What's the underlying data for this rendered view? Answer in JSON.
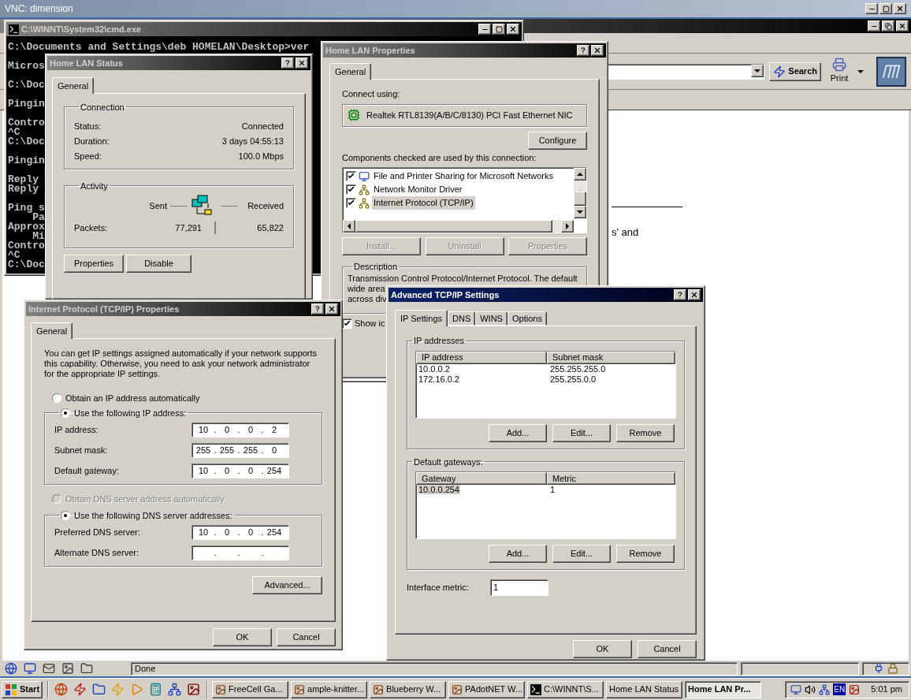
{
  "vnc": {
    "title": "VNC: dimension"
  },
  "browser": {
    "window": {
      "active": false
    },
    "search_button": "Search",
    "print_button": "Print",
    "content_text": "s' and",
    "status_text": "Done"
  },
  "cmd": {
    "window": {
      "title": "C:\\WINNT\\System32\\cmd.exe",
      "active": false
    },
    "blocks": [
      [
        "C:\\Documents and Settings\\deb HOMELAN\\Desktop>ver"
      ],
      [
        "Micros"
      ],
      [
        "C:\\Doc"
      ],
      [
        "Pingin"
      ],
      [
        "Contro",
        "^C",
        "C:\\Doc"
      ],
      [
        "Pingin"
      ],
      [
        "Reply",
        "Reply"
      ],
      [
        "Ping s",
        "    Pa",
        "Approx",
        "    Mi",
        "Contro",
        "^C",
        "C:\\Doc"
      ]
    ]
  },
  "lan_status": {
    "window": {
      "title": "Home LAN Status",
      "active": false
    },
    "tabs": [
      {
        "label": "General",
        "selected": true
      }
    ],
    "connection": {
      "title": "Connection",
      "rows": [
        {
          "label": "Status:",
          "value": "Connected"
        },
        {
          "label": "Duration:",
          "value": "3 days 04:55:13"
        },
        {
          "label": "Speed:",
          "value": "100.0 Mbps"
        }
      ]
    },
    "activity": {
      "title": "Activity",
      "sent_label": "Sent",
      "received_label": "Received",
      "packets_label": "Packets:",
      "packets_sent": "77,291",
      "packets_received": "65,822"
    },
    "buttons": [
      "Properties",
      "Disable"
    ]
  },
  "lan_properties": {
    "window": {
      "title": "Home LAN Properties",
      "active": false
    },
    "tabs": [
      {
        "label": "General",
        "selected": true
      }
    ],
    "connect_label": "Connect using:",
    "adapter": "Realtek RTL8139(A/B/C/8130) PCI Fast Ethernet NIC",
    "configure_button": "Configure",
    "components_label": "Components checked are used by this connection:",
    "components": [
      {
        "label": "File and Printer Sharing for Microsoft Networks",
        "kind": "service",
        "checked": true,
        "selected": false
      },
      {
        "label": "Network Monitor Driver",
        "kind": "protocol",
        "checked": true,
        "selected": false
      },
      {
        "label": "Internet Protocol (TCP/IP)",
        "kind": "protocol",
        "checked": true,
        "selected": true
      }
    ],
    "buttons": [
      {
        "label": "Install...",
        "disabled": true
      },
      {
        "label": "Uninstall",
        "disabled": true
      },
      {
        "label": "Properties",
        "disabled": true
      }
    ],
    "description": {
      "title": "Description",
      "lines": [
        "Transmission Control Protocol/Internet Protocol. The default",
        "wide area",
        "across div"
      ]
    },
    "show_icon": {
      "label": "Show ic",
      "checked": true
    }
  },
  "tcpip": {
    "window": {
      "title": "Internet Protocol (TCP/IP) Properties",
      "active": false
    },
    "tabs": [
      {
        "label": "General",
        "selected": true
      }
    ],
    "intro": "You can get IP settings assigned automatically if your network supports this capability. Otherwise, you need to ask your network administrator for the appropriate IP settings.",
    "ip_options": [
      {
        "label": "Obtain an IP address automatically",
        "selected": false,
        "disabled": false
      },
      {
        "label": "Use the following IP address:",
        "selected": true,
        "disabled": false
      }
    ],
    "ip_fields": [
      {
        "label": "IP address:",
        "octets": [
          "10",
          "0",
          "0",
          "2"
        ],
        "separator": "."
      },
      {
        "label": "Subnet mask:",
        "octets": [
          "255",
          "255",
          "255",
          "0"
        ],
        "separator": "."
      },
      {
        "label": "Default gateway:",
        "octets": [
          "10",
          "0",
          "0",
          "254"
        ],
        "separator": "."
      }
    ],
    "dns_options": [
      {
        "label": "Obtain DNS server address automatically",
        "selected": false,
        "disabled": true
      },
      {
        "label": "Use the following DNS server addresses:",
        "selected": true,
        "disabled": false
      }
    ],
    "dns_fields": [
      {
        "label": "Preferred DNS server:",
        "octets": [
          "10",
          "0",
          "0",
          "254"
        ],
        "separator": "."
      },
      {
        "label": "Alternate DNS server:",
        "separator": "."
      }
    ],
    "advanced_button": "Advanced...",
    "ok_button": "OK",
    "cancel_button": "Cancel"
  },
  "advanced": {
    "window": {
      "title": "Advanced TCP/IP Settings",
      "active": true
    },
    "tabs": [
      {
        "label": "IP Settings",
        "selected": true
      },
      {
        "label": "DNS",
        "selected": false
      },
      {
        "label": "WINS",
        "selected": false
      },
      {
        "label": "Options",
        "selected": false
      }
    ],
    "ip_addresses": {
      "title": "IP addresses",
      "columns": [
        "IP address",
        "Subnet mask"
      ],
      "rows": [
        {
          "cells": [
            "10.0.0.2",
            "255.255.255.0"
          ],
          "selected": false
        },
        {
          "cells": [
            "172.16.0.2",
            "255.255.0.0"
          ],
          "selected": false
        }
      ],
      "buttons": [
        "Add...",
        "Edit...",
        "Remove"
      ]
    },
    "gateways": {
      "title": "Default gateways:",
      "columns": [
        "Gateway",
        "Metric"
      ],
      "rows": [
        {
          "cells": [
            "10.0.0.254",
            "1"
          ],
          "selected": true
        }
      ],
      "buttons": [
        "Add...",
        "Edit...",
        "Remove"
      ]
    },
    "interface_metric": {
      "label": "Interface metric:",
      "value": "1"
    },
    "ok_button": "OK",
    "cancel_button": "Cancel"
  },
  "taskbar": {
    "start": "Start",
    "tasks": [
      {
        "label": "FreeCell Ga...",
        "kind": "app",
        "selected": false
      },
      {
        "label": "ample-knitter...",
        "kind": "app",
        "selected": false
      },
      {
        "label": "Blueberry W...",
        "kind": "app",
        "selected": false
      },
      {
        "label": "PAdotNET W...",
        "kind": "app",
        "selected": false
      },
      {
        "label": "C:\\WINNT\\S...",
        "kind": "console",
        "selected": false
      },
      {
        "label": "Home LAN Status",
        "kind": "dialog",
        "selected": false
      },
      {
        "label": "Home LAN Pr...",
        "kind": "dialog",
        "selected": true
      }
    ],
    "language": "EN",
    "clock": "5:01 pm"
  }
}
